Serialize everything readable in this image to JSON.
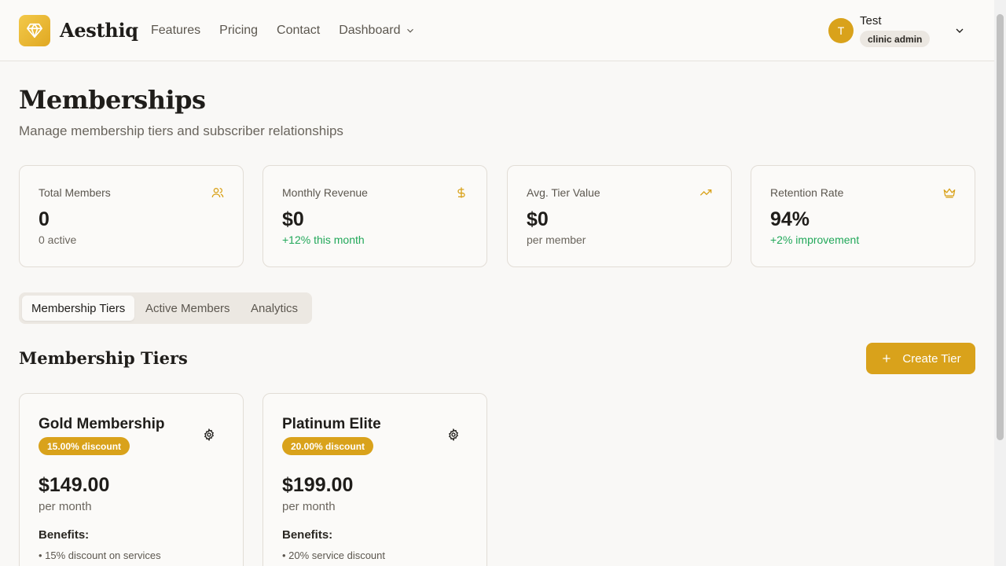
{
  "header": {
    "brand": "Aesthiq",
    "nav": [
      {
        "label": "Features"
      },
      {
        "label": "Pricing"
      },
      {
        "label": "Contact"
      },
      {
        "label": "Dashboard"
      }
    ],
    "user": {
      "initial": "T",
      "name": "Test",
      "role": "clinic admin"
    }
  },
  "page": {
    "title": "Memberships",
    "subtitle": "Manage membership tiers and subscriber relationships"
  },
  "stats": [
    {
      "label": "Total Members",
      "value": "0",
      "sub": "0 active",
      "icon": "users-icon"
    },
    {
      "label": "Monthly Revenue",
      "value": "$0",
      "sub": "+12% this month",
      "icon": "dollar-icon"
    },
    {
      "label": "Avg. Tier Value",
      "value": "$0",
      "sub": "per member",
      "icon": "trending-up-icon"
    },
    {
      "label": "Retention Rate",
      "value": "94%",
      "sub": "+2% improvement",
      "icon": "crown-icon"
    }
  ],
  "tabs": [
    {
      "label": "Membership Tiers",
      "active": true
    },
    {
      "label": "Active Members",
      "active": false
    },
    {
      "label": "Analytics",
      "active": false
    }
  ],
  "section": {
    "title": "Membership Tiers",
    "create_label": "Create Tier"
  },
  "tiers": [
    {
      "name": "Gold Membership",
      "discount": "15.00% discount",
      "price": "$149.00",
      "period": "per month",
      "benefits_label": "Benefits:",
      "benefit": "• 15% discount on services"
    },
    {
      "name": "Platinum Elite",
      "discount": "20.00% discount",
      "price": "$199.00",
      "period": "per month",
      "benefits_label": "Benefits:",
      "benefit": "• 20% service discount"
    }
  ],
  "colors": {
    "accent": "#d9a21b",
    "positive": "#22a85a",
    "background": "#f9f8f6"
  }
}
